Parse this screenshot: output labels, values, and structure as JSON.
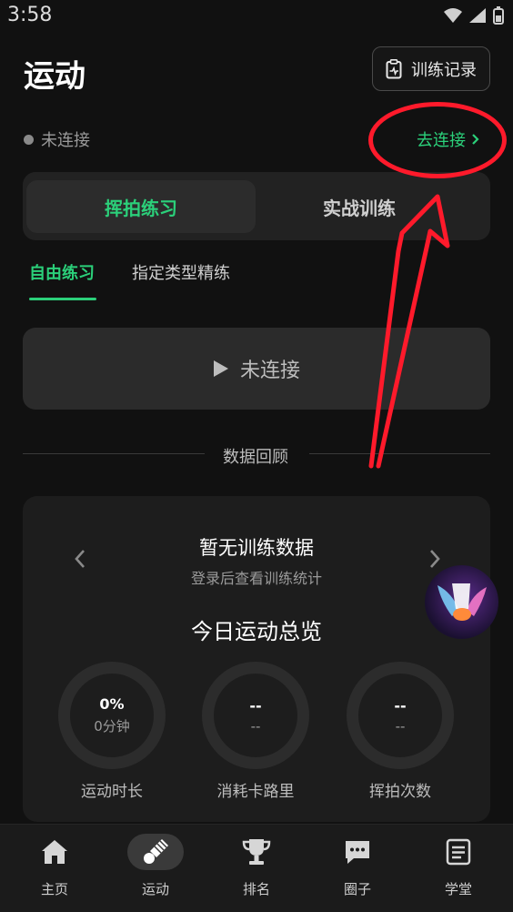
{
  "status_bar": {
    "time": "3:58"
  },
  "header": {
    "title": "运动",
    "records_label": "训练记录"
  },
  "connection": {
    "status": "未连接",
    "connect_label": "去连接"
  },
  "mode_tabs": [
    {
      "label": "挥拍练习",
      "active": true
    },
    {
      "label": "实战训练",
      "active": false
    }
  ],
  "sub_tabs": [
    {
      "label": "自由练习",
      "active": true
    },
    {
      "label": "指定类型精练",
      "active": false
    }
  ],
  "start_button": {
    "label": "未连接"
  },
  "review": {
    "divider_label": "数据回顾",
    "no_data_title": "暂无训练数据",
    "no_data_sub": "登录后查看训练统计",
    "overview_title": "今日运动总览",
    "stats": [
      {
        "value": "0%",
        "unit": "0分钟",
        "label": "运动时长"
      },
      {
        "value": "--",
        "unit": "--",
        "label": "消耗卡路里"
      },
      {
        "value": "--",
        "unit": "--",
        "label": "挥拍次数"
      }
    ]
  },
  "nav": [
    {
      "label": "主页",
      "icon": "home-icon",
      "active": false
    },
    {
      "label": "运动",
      "icon": "shuttlecock-icon",
      "active": true
    },
    {
      "label": "排名",
      "icon": "trophy-icon",
      "active": false
    },
    {
      "label": "圈子",
      "icon": "chat-icon",
      "active": false
    },
    {
      "label": "学堂",
      "icon": "document-icon",
      "active": false
    }
  ],
  "colors": {
    "accent": "#2bd07a",
    "annotation": "#ff1a2b",
    "background": "#111111"
  }
}
